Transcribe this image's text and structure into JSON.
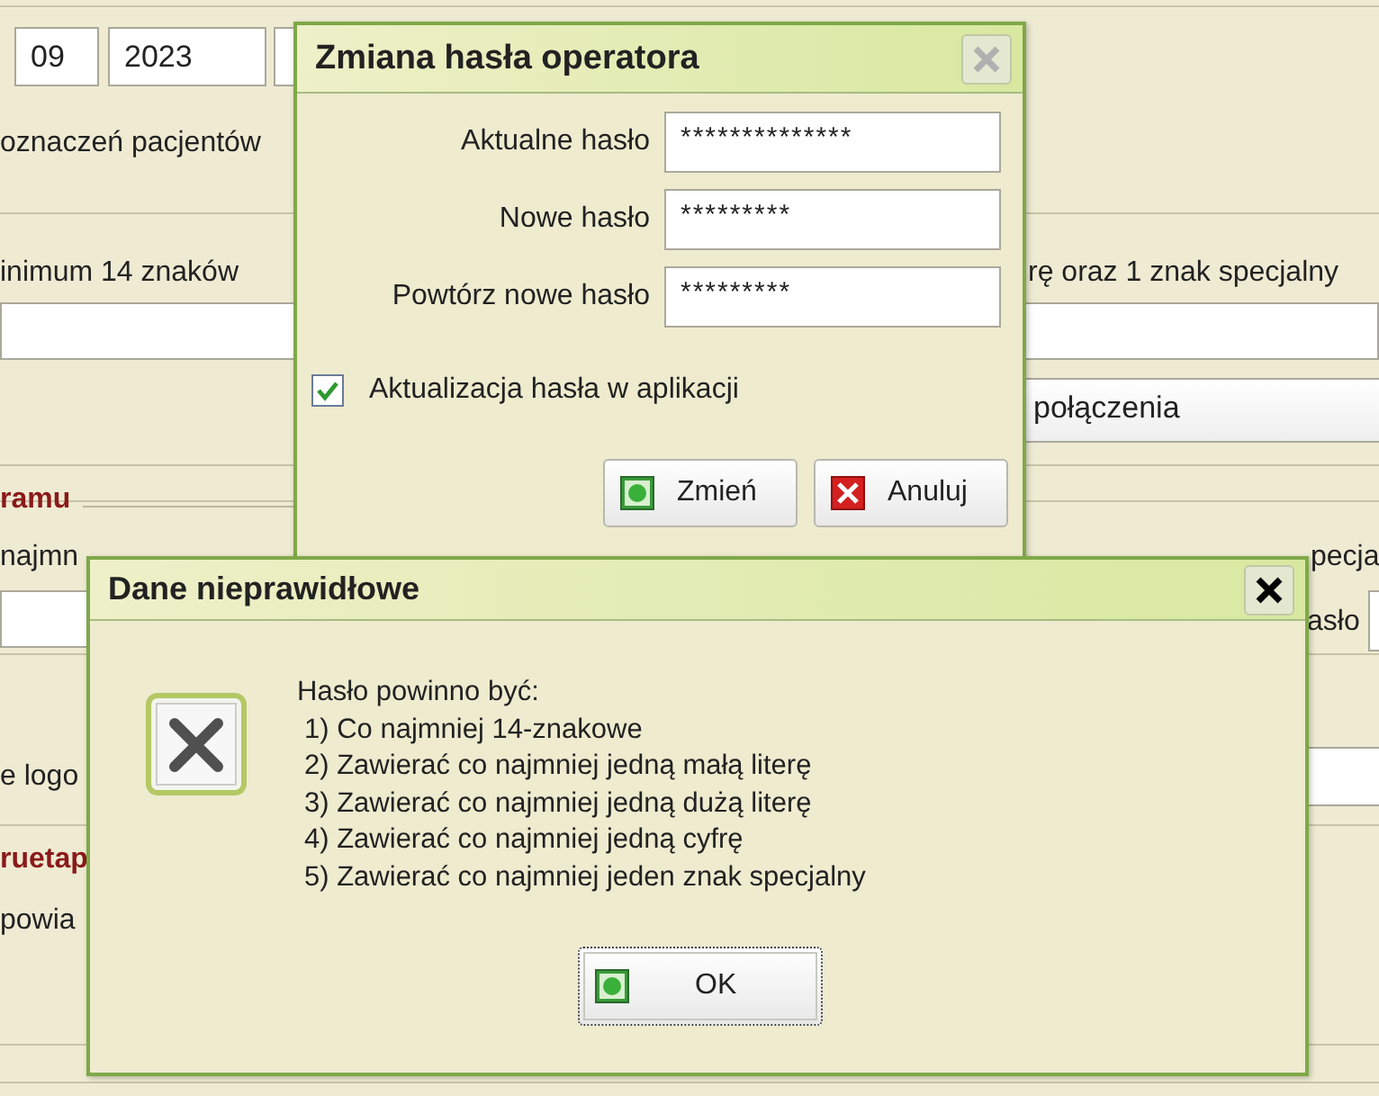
{
  "background": {
    "date_fields": [
      "09",
      "2023"
    ],
    "notice": "oznaczeń pacjentów",
    "rule_left": "inimum 14 znaków",
    "rule_right": "rę oraz 1 znak specjalny",
    "connection_select": "połączenia",
    "section_1_heading": "ramu",
    "text_1": "najmn",
    "text_right": "pecja",
    "field_label": "asło",
    "text_2": "e logo",
    "section_2_heading": "ruetap",
    "text_3": "powia"
  },
  "password_dialog": {
    "title": "Zmiana hasła operatora",
    "fields": [
      {
        "label": "Aktualne hasło",
        "value": "**************"
      },
      {
        "label": "Nowe hasło",
        "value": "*********"
      },
      {
        "label": "Powtórz nowe hasło",
        "value": "*********"
      }
    ],
    "checkbox": {
      "label": "Aktualizacja hasła w aplikacji",
      "checked": true
    },
    "buttons": [
      {
        "label": "Zmień",
        "kind": "confirm"
      },
      {
        "label": "Anuluj",
        "kind": "cancel"
      }
    ]
  },
  "error_dialog": {
    "title": "Dane nieprawidłowe",
    "message_title": "Hasło powinno być:",
    "requirements": [
      "1) Co najmniej 14-znakowe",
      "2) Zawierać co najmniej jedną małą literę",
      "3) Zawierać co najmniej jedną dużą literę",
      "4) Zawierać co najmniej jedną cyfrę",
      "5) Zawierać co najmniej jeden znak specjalny"
    ],
    "button": {
      "label": "OK",
      "kind": "confirm"
    }
  }
}
